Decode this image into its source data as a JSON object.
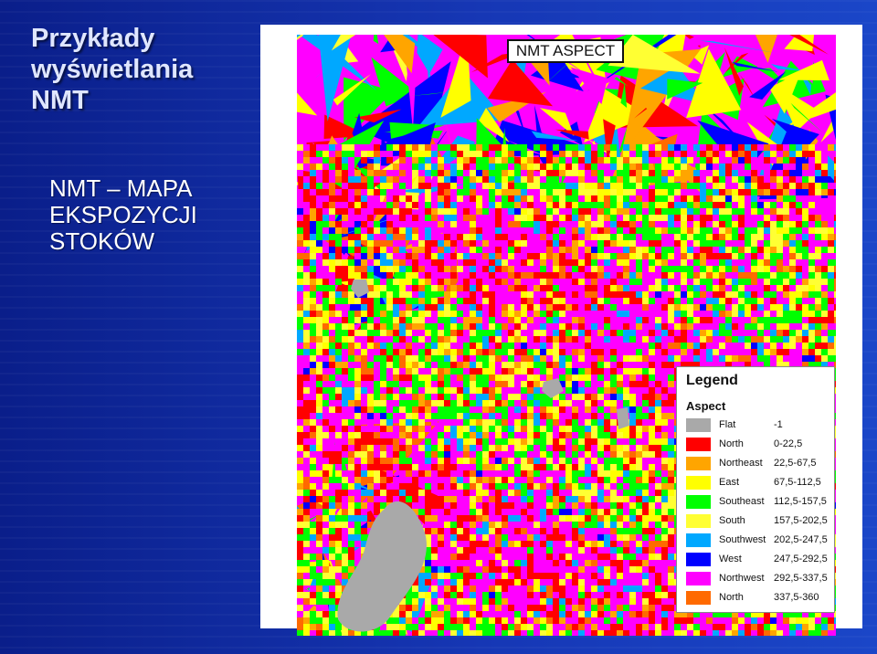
{
  "slide": {
    "title_lines": [
      "Przykłady",
      "wyświetlania",
      "NMT"
    ],
    "subtitle_lines": [
      "NMT – MAPA",
      "EKSPOZYCJI",
      "STOKÓW"
    ]
  },
  "map": {
    "title": "NMT ASPECT",
    "legend": {
      "title": "Legend",
      "subtitle": "Aspect",
      "items": [
        {
          "label": "Flat",
          "range": "-1",
          "color": "#a9a9a9"
        },
        {
          "label": "North",
          "range": "0-22,5",
          "color": "#ff0000"
        },
        {
          "label": "Northeast",
          "range": "22,5-67,5",
          "color": "#ffa500"
        },
        {
          "label": "East",
          "range": "67,5-112,5",
          "color": "#ffff00"
        },
        {
          "label": "Southeast",
          "range": "112,5-157,5",
          "color": "#00ff00"
        },
        {
          "label": "South",
          "range": "157,5-202,5",
          "color": "#ffff33"
        },
        {
          "label": "Southwest",
          "range": "202,5-247,5",
          "color": "#00a8ff"
        },
        {
          "label": "West",
          "range": "247,5-292,5",
          "color": "#0000ff"
        },
        {
          "label": "Northwest",
          "range": "292,5-337,5",
          "color": "#ff00ff"
        },
        {
          "label": "North",
          "range": "337,5-360",
          "color": "#ff6a00"
        }
      ]
    }
  }
}
